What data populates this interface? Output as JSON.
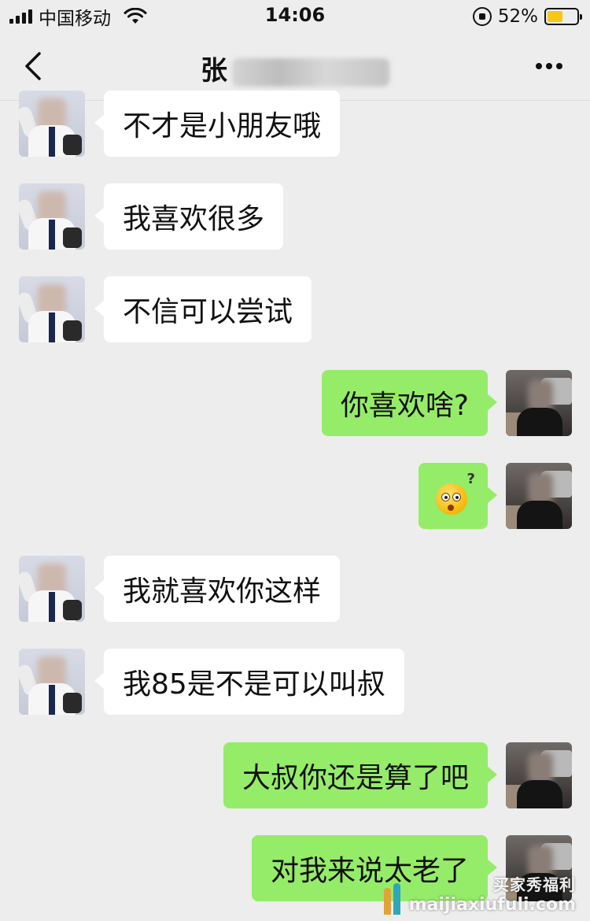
{
  "status_bar": {
    "carrier": "中国移动",
    "time": "14:06",
    "battery_percent": "52%",
    "battery_level": 0.52,
    "battery_color": "#f6c719"
  },
  "nav": {
    "title_visible": "张",
    "back_icon": "chevron-left-icon",
    "more_icon": "more-dots-icon"
  },
  "colors": {
    "background": "#ededed",
    "sent_bubble": "#95ec69",
    "received_bubble": "#ffffff"
  },
  "messages": [
    {
      "from": "friend",
      "text": "不才是小朋友哦"
    },
    {
      "from": "friend",
      "text": "我喜欢很多"
    },
    {
      "from": "friend",
      "text": "不信可以尝试"
    },
    {
      "from": "me",
      "text": "你喜欢啥?"
    },
    {
      "from": "me",
      "text": "",
      "emoji": "confused-face-emoji"
    },
    {
      "from": "friend",
      "text": "我就喜欢你这样"
    },
    {
      "from": "friend",
      "text": "我85是不是可以叫叔"
    },
    {
      "from": "me",
      "text": "大叔你还是算了吧"
    },
    {
      "from": "me",
      "text": "对我来说太老了"
    }
  ],
  "watermark": {
    "line1": "买家秀福利",
    "line2": "maijiaxiufuli.com"
  }
}
